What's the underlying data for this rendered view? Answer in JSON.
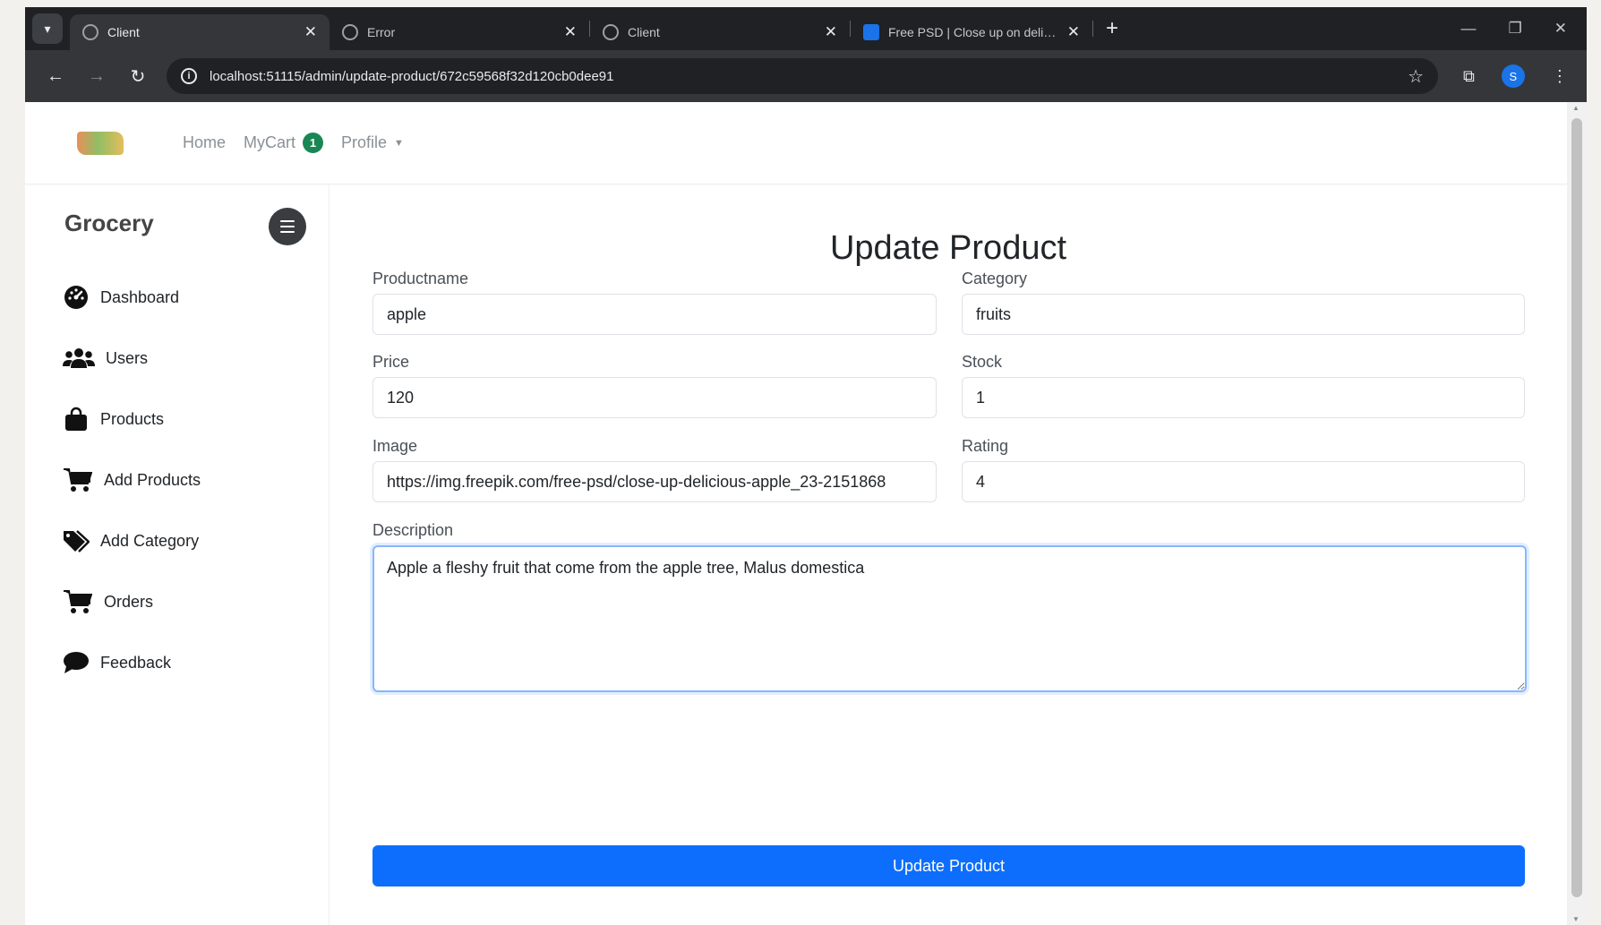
{
  "browser": {
    "tabs": [
      {
        "label": "Client",
        "active": true
      },
      {
        "label": "Error",
        "active": false
      },
      {
        "label": "Client",
        "active": false
      },
      {
        "label": "Free PSD | Close up on delicious",
        "active": false
      }
    ],
    "url": "localhost:51115/admin/update-product/672c59568f32d120cb0dee91",
    "profile_initial": "S"
  },
  "topnav": {
    "home": "Home",
    "mycart": "MyCart",
    "cart_count": "1",
    "profile": "Profile"
  },
  "sidebar": {
    "title": "Grocery",
    "items": [
      {
        "label": "Dashboard",
        "icon": "dashboard-icon"
      },
      {
        "label": "Users",
        "icon": "users-icon"
      },
      {
        "label": "Products",
        "icon": "shopping-bag-icon"
      },
      {
        "label": "Add Products",
        "icon": "cart-icon"
      },
      {
        "label": "Add Category",
        "icon": "tags-icon"
      },
      {
        "label": "Orders",
        "icon": "cart-icon"
      },
      {
        "label": "Feedback",
        "icon": "comment-icon"
      }
    ]
  },
  "form": {
    "title": "Update Product",
    "productname_label": "Productname",
    "productname_value": "apple",
    "category_label": "Category",
    "category_value": "fruits",
    "price_label": "Price",
    "price_value": "120",
    "stock_label": "Stock",
    "stock_value": "1",
    "image_label": "Image",
    "image_value": "https://img.freepik.com/free-psd/close-up-delicious-apple_23-2151868",
    "rating_label": "Rating",
    "rating_value": "4",
    "description_label": "Description",
    "description_value": "Apple a fleshy fruit that come from the apple tree, Malus domestica",
    "submit_label": "Update Product"
  },
  "colors": {
    "primary": "#0d6efd",
    "badge": "#198754",
    "chrome_dark": "#202124"
  }
}
